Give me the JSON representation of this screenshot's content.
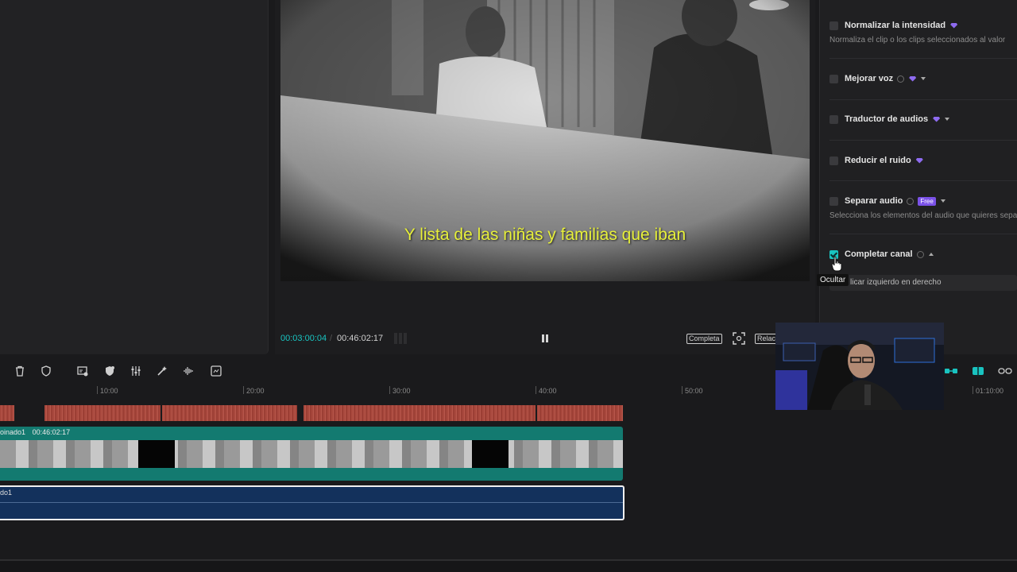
{
  "player": {
    "subtitle": "Y lista de las niñas y familias que iban",
    "time_current": "00:03:00:04",
    "time_separator": "/",
    "time_total": "00:46:02:17",
    "ratio_label": "Completa",
    "aspect_label": "Relación"
  },
  "audio_panel": {
    "options": [
      {
        "label": "Normalizar la intensidad",
        "desc": "Normaliza el clip o los clips seleccionados al valor"
      },
      {
        "label": "Mejorar voz"
      },
      {
        "label": "Traductor de audios"
      },
      {
        "label": "Reducir el ruido"
      },
      {
        "label": "Separar audio",
        "badge": "Free",
        "desc": "Selecciona los elementos del audio que quieres separar"
      },
      {
        "label": "Completar canal",
        "checked": true
      }
    ],
    "channel_select_value": "licar izquierdo en derecho",
    "tooltip": "Ocultar"
  },
  "timeline": {
    "ruler_labels": [
      "10:00",
      "20:00",
      "30:00",
      "40:00",
      "50:00",
      "01:10:00"
    ],
    "video_clip_name": "oinado1",
    "video_clip_duration": "00:46:02:17",
    "text_clip_name": "do1",
    "black_frame_text": "▬▬▬▬"
  },
  "colors": {
    "accent": "#19c3c0",
    "subtitle": "#e7f03a",
    "premium": "#8e6bf0",
    "audio_track": "#a8483d",
    "video_track": "#137a70",
    "text_track": "#13315c"
  }
}
